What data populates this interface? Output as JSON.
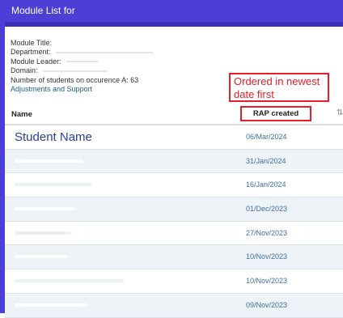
{
  "window": {
    "title": "Module List for"
  },
  "info": {
    "module_title_label": "Module Title:",
    "department_label": "Department:",
    "module_leader_label": "Module Leader:",
    "domain_label": "Domain:",
    "students_count_label": "Number of students on occurence A: 63",
    "adjustments_link": "Adjustments and Support"
  },
  "annotation": {
    "text": "Ordered in newest date first"
  },
  "table": {
    "columns": {
      "name": "Name",
      "rap_created": "RAP created"
    },
    "rows": [
      {
        "name": "Student Name",
        "date": "06/Mar/2024"
      },
      {
        "name": "",
        "date": "31/Jan/2024"
      },
      {
        "name": "",
        "date": "16/Jan/2024"
      },
      {
        "name": "",
        "date": "01/Dec/2023"
      },
      {
        "name": "",
        "date": "27/Nov/2023"
      },
      {
        "name": "",
        "date": "10/Nov/2023"
      },
      {
        "name": "",
        "date": "10/Nov/2023"
      },
      {
        "name": "",
        "date": "09/Nov/2023"
      }
    ]
  },
  "colors": {
    "title_bar": "#4b3fd6",
    "annotation": "#e0202a",
    "row_alt": "#eef3f8",
    "date_text": "#3f6f9c"
  },
  "icons": {
    "sort": "sort-icon"
  }
}
